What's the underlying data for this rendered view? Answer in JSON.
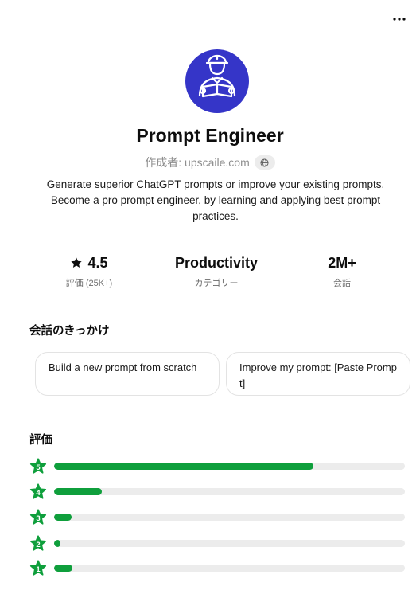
{
  "header": {
    "more_icon": "more-horizontal-icon"
  },
  "profile": {
    "title": "Prompt Engineer",
    "author": "作成者: upscaile.com",
    "avatar_icon": "engineer-with-blueprint-icon",
    "avatar_color": "#3535c8",
    "description": "Generate superior ChatGPT prompts or improve your existing prompts. Become a pro prompt engineer, by learning and applying best prompt practices."
  },
  "stats": [
    {
      "value": "4.5",
      "label": "評価 (25K+)",
      "icon": "star-icon"
    },
    {
      "value": "Productivity",
      "label": "カテゴリー"
    },
    {
      "value": "2M+",
      "label": "会話"
    }
  ],
  "starters": {
    "title": "会話のきっかけ",
    "items": [
      {
        "label": "Build a new prompt from scratch"
      },
      {
        "label": "Improve my prompt: [Paste Prompt]"
      }
    ]
  },
  "ratings": {
    "title": "評価",
    "accent": "#0f9f3c",
    "rows": [
      {
        "stars": "5",
        "fraction": 0.74
      },
      {
        "stars": "4",
        "fraction": 0.137
      },
      {
        "stars": "3",
        "fraction": 0.05
      },
      {
        "stars": "2",
        "fraction": 0.019
      },
      {
        "stars": "1",
        "fraction": 0.053
      }
    ]
  }
}
